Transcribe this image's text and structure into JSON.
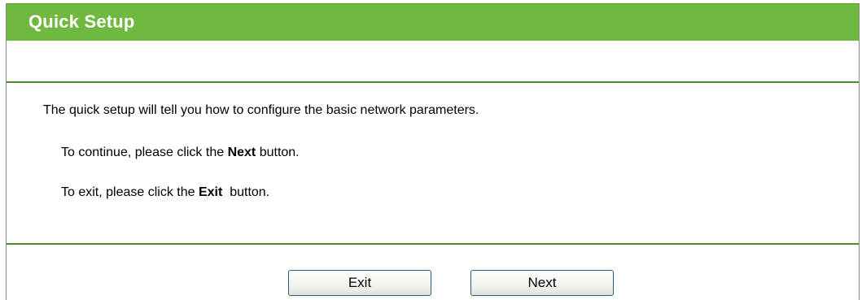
{
  "panel": {
    "title": "Quick Setup"
  },
  "content": {
    "intro": "The quick setup will tell you how to configure the basic network parameters.",
    "continue_prefix": "To continue, please click the ",
    "continue_keyword": "Next",
    "continue_suffix": " button.",
    "exit_prefix": "To exit, please click the ",
    "exit_keyword": "Exit",
    "exit_suffix": "  button."
  },
  "buttons": {
    "exit_label": "Exit",
    "next_label": "Next"
  },
  "colors": {
    "title_bar": "#6fb941",
    "divider": "#4e8f2c",
    "title_text": "#ffffff",
    "button_border": "#2e5c86"
  }
}
